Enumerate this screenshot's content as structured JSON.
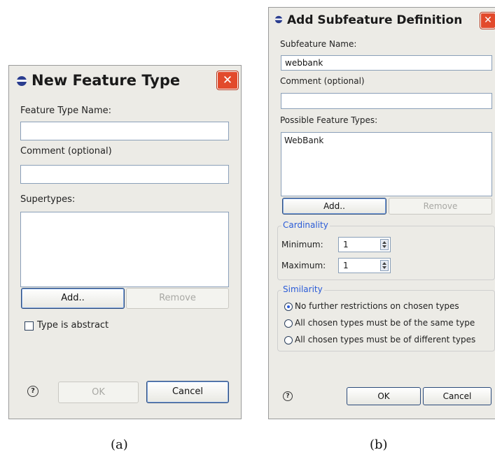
{
  "dialog_a": {
    "title": "New Feature Type",
    "close_icon_text": "✕",
    "feature_type_name_label": "Feature Type Name:",
    "feature_type_name_value": "",
    "comment_label": "Comment (optional)",
    "comment_value": "",
    "supertypes_label": "Supertypes:",
    "add_label": "Add..",
    "remove_label": "Remove",
    "abstract_label": "Type is abstract",
    "help_glyph": "?",
    "ok_label": "OK",
    "cancel_label": "Cancel"
  },
  "dialog_b": {
    "title": "Add Subfeature Definition",
    "close_icon_text": "✕",
    "subfeature_name_label": "Subfeature Name:",
    "subfeature_name_value": "webbank",
    "comment_label": "Comment (optional)",
    "comment_value": "",
    "possible_types_label": "Possible Feature Types:",
    "possible_types_items": [
      "WebBank"
    ],
    "add_label": "Add..",
    "remove_label": "Remove",
    "cardinality_title": "Cardinality",
    "minimum_label": "Minimum:",
    "minimum_value": "1",
    "maximum_label": "Maximum:",
    "maximum_value": "1",
    "similarity_title": "Similarity",
    "similarity_options": [
      "No further restrictions on chosen types",
      "All chosen types must be of the same type",
      "All chosen types must be of different types"
    ],
    "similarity_selected": 0,
    "help_glyph": "?",
    "ok_label": "OK",
    "cancel_label": "Cancel"
  },
  "captions": {
    "a": "(a)",
    "b": "(b)"
  },
  "colors": {
    "close_red": "#e24a2c",
    "group_blue": "#2a5bd7",
    "dialog_bg": "#ecebe6"
  }
}
